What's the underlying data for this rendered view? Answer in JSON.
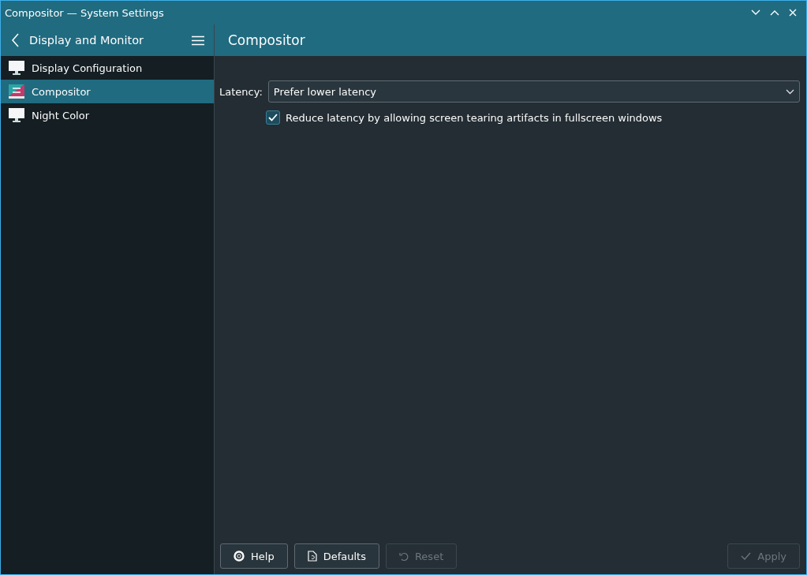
{
  "window": {
    "title": "Compositor — System Settings"
  },
  "sidebar": {
    "title": "Display and Monitor",
    "items": [
      {
        "label": "Display Configuration",
        "kind": "monitor",
        "selected": false
      },
      {
        "label": "Compositor",
        "kind": "compositor",
        "selected": true
      },
      {
        "label": "Night Color",
        "kind": "monitor",
        "selected": false
      }
    ]
  },
  "page": {
    "title": "Compositor",
    "latency": {
      "label": "Latency:",
      "value": "Prefer lower latency"
    },
    "tearing": {
      "label": "Reduce latency by allowing screen tearing artifacts in fullscreen windows",
      "checked": true
    }
  },
  "buttons": [
    {
      "label": "Help",
      "kind": "help",
      "disabled": false
    },
    {
      "label": "Defaults",
      "kind": "defaults",
      "disabled": false
    },
    {
      "label": "Reset",
      "kind": "reset",
      "disabled": true
    },
    {
      "label": "Apply",
      "kind": "apply",
      "disabled": true
    }
  ]
}
